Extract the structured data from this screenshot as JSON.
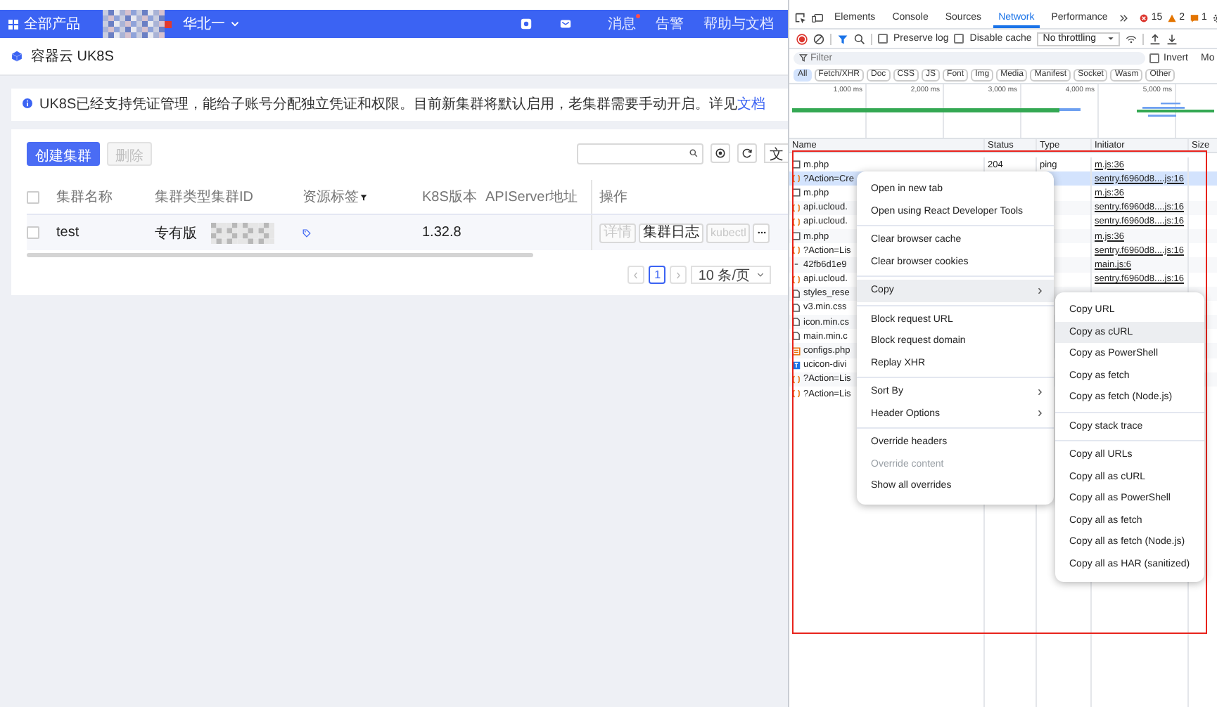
{
  "header": {
    "menu_label": "全部产品",
    "region": "华北一",
    "nav": [
      {
        "label": "消息",
        "badge": true
      },
      {
        "label": "告警",
        "badge": false
      },
      {
        "label": "帮助与文档",
        "badge": false
      }
    ]
  },
  "page_title": "容器云 UK8S",
  "notice": {
    "text": "UK8S已经支持凭证管理，能给子账号分配独立凭证和权限。目前新集群将默认启用，老集群需要手动开启。详见",
    "link": "文档"
  },
  "toolbar": {
    "buttons": [
      {
        "label": "创建集群",
        "kind": "primary",
        "disabled": false
      },
      {
        "label": "删除",
        "kind": "default",
        "disabled": true
      }
    ],
    "cut_button": "文"
  },
  "table": {
    "select_all_checked": false,
    "columns": [
      {
        "label": "集群名称",
        "filter": false
      },
      {
        "label": "集群类型",
        "filter": false
      },
      {
        "label": "集群ID",
        "filter": false
      },
      {
        "label": "资源标签",
        "filter": true
      },
      {
        "label": "K8S版本",
        "filter": false
      },
      {
        "label": "APIServer地址",
        "filter": false
      },
      {
        "label": "操作",
        "filter": false
      }
    ],
    "rows": [
      {
        "checked": false,
        "name": "test",
        "type": "专有版",
        "k8s_version": "1.32.8",
        "actions": [
          {
            "label": "详情",
            "disabled": true
          },
          {
            "label": "集群日志",
            "disabled": false
          },
          {
            "label": "kubectl",
            "disabled": true
          }
        ]
      }
    ]
  },
  "pagination": {
    "pages": [
      {
        "label": "1",
        "selected": true
      }
    ],
    "page_size": "10 条/页"
  },
  "devtools": {
    "tabs": [
      {
        "label": "Elements",
        "selected": false
      },
      {
        "label": "Console",
        "selected": false
      },
      {
        "label": "Sources",
        "selected": false
      },
      {
        "label": "Network",
        "selected": true
      },
      {
        "label": "Performance",
        "selected": false
      }
    ],
    "counts": [
      {
        "kind": "error",
        "value": "15"
      },
      {
        "kind": "warning",
        "value": "2"
      },
      {
        "kind": "info",
        "value": "1"
      }
    ],
    "options": [
      {
        "label": "Preserve log",
        "checked": false
      },
      {
        "label": "Disable cache",
        "checked": false
      }
    ],
    "throttling": "No throttling",
    "filter_placeholder": "Filter",
    "invert": {
      "label": "Invert",
      "checked": false
    },
    "cut_option": "Mo",
    "type_filters": [
      {
        "label": "All",
        "selected": true
      },
      {
        "label": "Fetch/XHR",
        "selected": false
      },
      {
        "label": "Doc",
        "selected": false
      },
      {
        "label": "CSS",
        "selected": false
      },
      {
        "label": "JS",
        "selected": false
      },
      {
        "label": "Font",
        "selected": false
      },
      {
        "label": "Img",
        "selected": false
      },
      {
        "label": "Media",
        "selected": false
      },
      {
        "label": "Manifest",
        "selected": false
      },
      {
        "label": "Socket",
        "selected": false
      },
      {
        "label": "Wasm",
        "selected": false
      },
      {
        "label": "Other",
        "selected": false
      }
    ],
    "timeline_ticks": [
      "1,000 ms",
      "2,000 ms",
      "3,000 ms",
      "4,000 ms",
      "5,000 ms"
    ],
    "columns": [
      "Name",
      "Status",
      "Type",
      "Initiator",
      "Size"
    ],
    "requests": [
      {
        "name": "m.php",
        "kind": "ping",
        "selected": false,
        "status": "204",
        "type": "ping",
        "initiator": "m.js:36"
      },
      {
        "name": "?Action=Cre",
        "kind": "fetch",
        "selected": true,
        "initiator": "sentry.f6960d8....js:16"
      },
      {
        "name": "m.php",
        "kind": "ping",
        "selected": false,
        "initiator": "m.js:36"
      },
      {
        "name": "api.ucloud.",
        "kind": "fetch",
        "selected": false,
        "initiator": "sentry.f6960d8....js:16"
      },
      {
        "name": "api.ucloud.",
        "kind": "fetch",
        "selected": false,
        "initiator": "sentry.f6960d8....js:16"
      },
      {
        "name": "m.php",
        "kind": "ping",
        "selected": false,
        "initiator": "m.js:36"
      },
      {
        "name": "?Action=Lis",
        "kind": "fetch",
        "selected": false,
        "initiator": "sentry.f6960d8....js:16"
      },
      {
        "name": "42fb6d1e9",
        "kind": "other",
        "selected": false,
        "initiator": "main.js:6"
      },
      {
        "name": "api.ucloud.",
        "kind": "fetch",
        "selected": false,
        "initiator": "sentry.f6960d8....js:16"
      },
      {
        "name": "styles_rese",
        "kind": "stylesheet",
        "selected": false
      },
      {
        "name": "v3.min.css",
        "kind": "stylesheet",
        "selected": false
      },
      {
        "name": "icon.min.cs",
        "kind": "stylesheet",
        "selected": false
      },
      {
        "name": "main.min.c",
        "kind": "stylesheet",
        "selected": false
      },
      {
        "name": "configs.php",
        "kind": "image",
        "selected": false
      },
      {
        "name": "ucicon-divi",
        "kind": "font",
        "selected": false
      },
      {
        "name": "?Action=Lis",
        "kind": "fetch",
        "selected": false
      },
      {
        "name": "?Action=Lis",
        "kind": "fetch",
        "selected": false
      }
    ]
  },
  "context_menu": {
    "groups": [
      [
        {
          "label": "Open in new tab",
          "submenu": false,
          "disabled": false,
          "highlighted": false
        },
        {
          "label": "Open using React Developer Tools",
          "submenu": false,
          "disabled": false,
          "highlighted": false
        }
      ],
      [
        {
          "label": "Clear browser cache",
          "submenu": false,
          "disabled": false,
          "highlighted": false
        },
        {
          "label": "Clear browser cookies",
          "submenu": false,
          "disabled": false,
          "highlighted": false
        }
      ],
      [
        {
          "label": "Copy",
          "submenu": true,
          "disabled": false,
          "highlighted": true
        }
      ],
      [
        {
          "label": "Block request URL",
          "submenu": false,
          "disabled": false,
          "highlighted": false
        },
        {
          "label": "Block request domain",
          "submenu": false,
          "disabled": false,
          "highlighted": false
        },
        {
          "label": "Replay XHR",
          "submenu": false,
          "disabled": false,
          "highlighted": false
        }
      ],
      [
        {
          "label": "Sort By",
          "submenu": true,
          "disabled": false,
          "highlighted": false
        },
        {
          "label": "Header Options",
          "submenu": true,
          "disabled": false,
          "highlighted": false
        }
      ],
      [
        {
          "label": "Override headers",
          "submenu": false,
          "disabled": false,
          "highlighted": false
        },
        {
          "label": "Override content",
          "submenu": false,
          "disabled": true,
          "highlighted": false
        },
        {
          "label": "Show all overrides",
          "submenu": false,
          "disabled": false,
          "highlighted": false
        }
      ]
    ]
  },
  "submenu": {
    "groups": [
      [
        {
          "label": "Copy URL",
          "highlighted": false
        },
        {
          "label": "Copy as cURL",
          "highlighted": true
        },
        {
          "label": "Copy as PowerShell",
          "highlighted": false
        },
        {
          "label": "Copy as fetch",
          "highlighted": false
        },
        {
          "label": "Copy as fetch (Node.js)",
          "highlighted": false
        }
      ],
      [
        {
          "label": "Copy stack trace",
          "highlighted": false
        }
      ],
      [
        {
          "label": "Copy all URLs",
          "highlighted": false
        },
        {
          "label": "Copy all as cURL",
          "highlighted": false
        },
        {
          "label": "Copy all as PowerShell",
          "highlighted": false
        },
        {
          "label": "Copy all as fetch",
          "highlighted": false
        },
        {
          "label": "Copy all as fetch (Node.js)",
          "highlighted": false
        },
        {
          "label": "Copy all as HAR (sanitized)",
          "highlighted": false
        }
      ]
    ]
  }
}
